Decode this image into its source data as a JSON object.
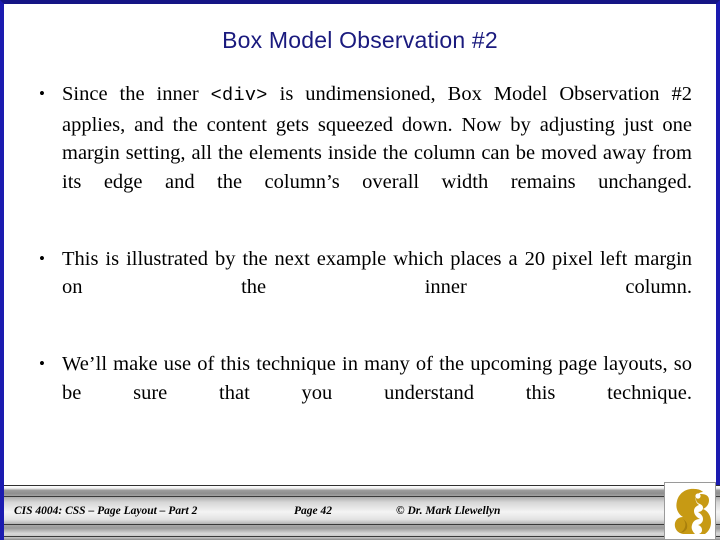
{
  "slide": {
    "title": "Box Model Observation #2",
    "accent_color": "#1a1a7e",
    "border_color": "#1b1bb0",
    "logo_color": "#c79a14"
  },
  "bullets": [
    {
      "marker": "•",
      "segments": [
        {
          "type": "text",
          "value": "Since the inner "
        },
        {
          "type": "code",
          "value": "<div>"
        },
        {
          "type": "text",
          "value": " is undimensioned, Box Model Observation #2 applies, and the content gets squeezed down.  Now by adjusting just one margin setting, all the elements inside the column can be moved away from its edge and the column’s overall width remains unchanged."
        }
      ],
      "text_part1": "Since the inner ",
      "code_part": "<div>",
      "text_part2": " is undimensioned, Box Model Observation #2 applies, and the content gets squeezed down.  Now by adjusting just one margin setting, all the elements inside the column can be moved away from its edge and the column’s overall width remains unchanged."
    },
    {
      "marker": "•",
      "text": "This is illustrated by the next example which places a 20 pixel left margin on the inner column."
    },
    {
      "marker": "•",
      "text": "We’ll make use of this technique in many of the upcoming page layouts, so be sure that you understand this technique."
    }
  ],
  "footer": {
    "course": "CIS 4004: CSS – Page Layout – Part 2",
    "page_number": "Page 42",
    "copyright": "© Dr. Mark Llewellyn",
    "logo": "pegasus-logo"
  }
}
